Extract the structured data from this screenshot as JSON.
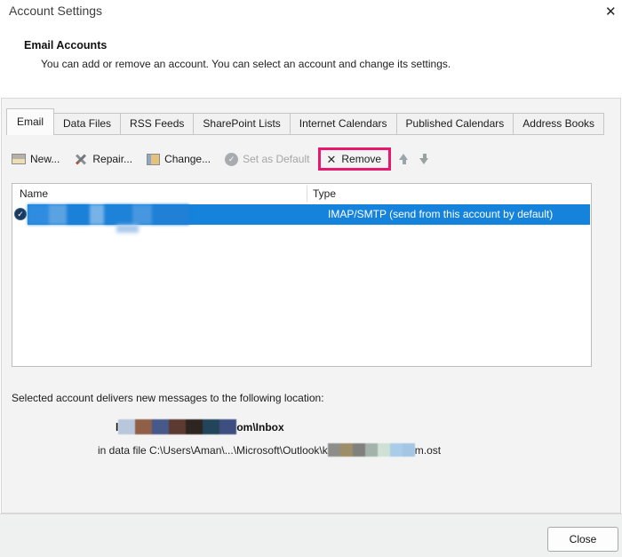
{
  "window": {
    "title": "Account Settings",
    "close_icon_glyph": "✕"
  },
  "header": {
    "section_title": "Email Accounts",
    "description": "You can add or remove an account. You can select an account and change its settings."
  },
  "tabs": [
    {
      "label": "Email",
      "active": true
    },
    {
      "label": "Data Files",
      "active": false
    },
    {
      "label": "RSS Feeds",
      "active": false
    },
    {
      "label": "SharePoint Lists",
      "active": false
    },
    {
      "label": "Internet Calendars",
      "active": false
    },
    {
      "label": "Published Calendars",
      "active": false
    },
    {
      "label": "Address Books",
      "active": false
    }
  ],
  "toolbar": {
    "new_label": "New...",
    "repair_label": "Repair...",
    "change_label": "Change...",
    "set_default_label": "Set as Default",
    "set_default_disabled": true,
    "remove_label": "Remove",
    "remove_icon_glyph": "✕",
    "check_glyph": "✓",
    "highlight_color": "#e6196e"
  },
  "table": {
    "columns": [
      "Name",
      "Type"
    ],
    "rows": [
      {
        "name": "(redacted)",
        "type": "IMAP/SMTP (send from this account by default)",
        "selected": true,
        "is_default": true
      }
    ],
    "selection_color": "#1583db",
    "badge_glyph": "✓"
  },
  "details": {
    "deliver_text": "Selected account delivers new messages to the following location:",
    "account_path_prefix": "l",
    "account_path_suffix": "om\\Inbox",
    "data_file_prefix": "in data file C:\\Users\\Aman\\...\\Microsoft\\Outlook\\k",
    "data_file_suffix": "m.ost"
  },
  "redaction": {
    "account_tiles": [
      "#b9c7dc",
      "#8f5f47",
      "#46598a",
      "#5c3a31",
      "#2e2420",
      "#23455c",
      "#3e4e80"
    ],
    "file_tiles": [
      "#8d8d89",
      "#9d8d68",
      "#80807e",
      "#a3b2aa",
      "#cfe0d4",
      "#a9cce8",
      "#a2c6e4"
    ]
  },
  "footer": {
    "close_label": "Close"
  }
}
